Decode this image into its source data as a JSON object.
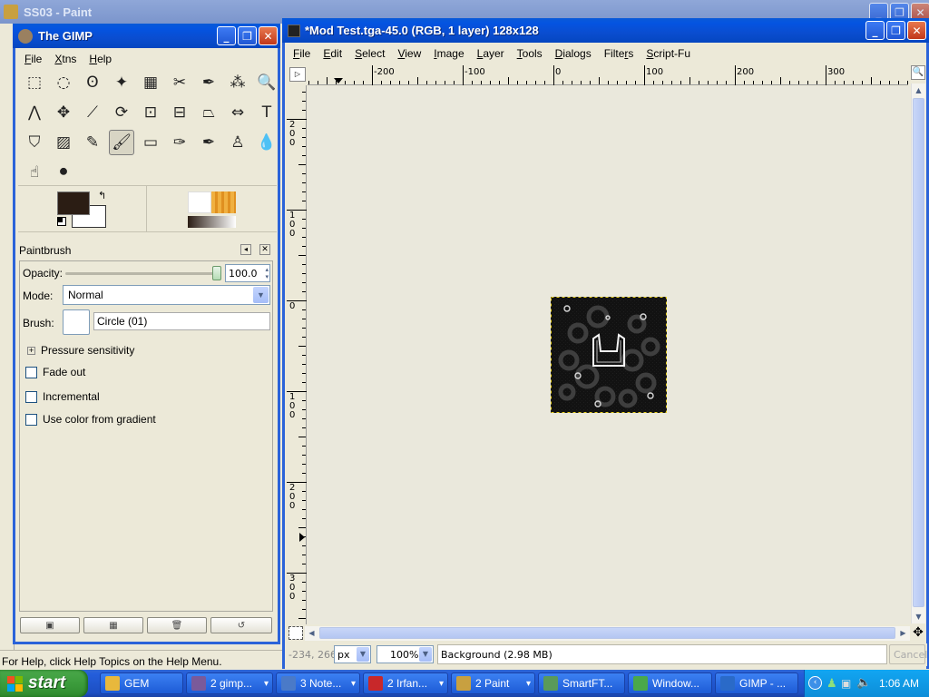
{
  "paint_window": {
    "title": "SS03 - Paint",
    "status": "For Help, click Help Topics on the Help Menu."
  },
  "toolbox": {
    "title": "The GIMP",
    "menu": [
      "File",
      "Xtns",
      "Help"
    ],
    "menu_underline": [
      "F",
      "X",
      "H"
    ],
    "colors": {
      "fg": "#2b1d14",
      "bg": "#ffffff"
    },
    "tools": [
      "rect-select",
      "ellipse-select",
      "free-select",
      "fuzzy-select",
      "select-by-color",
      "scissors",
      "paths",
      "color-picker",
      "zoom",
      "measure",
      "move",
      "crop",
      "rotate",
      "scale",
      "shear",
      "perspective",
      "flip",
      "text",
      "bucket-fill",
      "blend",
      "pencil",
      "paintbrush",
      "eraser",
      "airbrush",
      "ink",
      "clone",
      "convolve",
      "smudge",
      "dodge-burn"
    ],
    "tool_glyphs": [
      "⬚",
      "◌",
      "ʘ",
      "✦",
      "▦",
      "✂",
      "✒",
      "⁂",
      "🔍",
      "⋀",
      "✥",
      "⟋",
      "⟳",
      "⊡",
      "⊟",
      "⏢",
      "⇔",
      "T",
      "⛉",
      "▨",
      "✎",
      "🖌",
      "▭",
      "✑",
      "✒",
      "♙",
      "💧",
      "☝",
      "⚫"
    ]
  },
  "tool_options": {
    "title": "Paintbrush",
    "opacity_label": "Opacity:",
    "opacity_value": "100.0",
    "opacity_level": 100,
    "mode_label": "Mode:",
    "mode_value": "Normal",
    "brush_label": "Brush:",
    "brush_value": "Circle (01)",
    "pressure_label": "Pressure sensitivity",
    "fade_label": "Fade out",
    "incremental_label": "Incremental",
    "gradient_label": "Use color from gradient"
  },
  "image_window": {
    "title": "*Mod Test.tga-45.0 (RGB, 1 layer) 128x128",
    "menu": [
      "File",
      "Edit",
      "Select",
      "View",
      "Image",
      "Layer",
      "Tools",
      "Dialogs",
      "Filters",
      "Script-Fu"
    ],
    "menu_underline": [
      "F",
      "E",
      "S",
      "V",
      "I",
      "L",
      "T",
      "D",
      "r",
      "S"
    ],
    "hruler": [
      "-200",
      "-100",
      "0",
      "100",
      "200",
      "300"
    ],
    "vruler": [
      "1\n0\n0",
      "2\n0\n0",
      "1\n0\n0",
      "0",
      "1\n0\n0",
      "2\n0\n0",
      "3\n0\n0"
    ],
    "coords": "-234, 266",
    "unit": "px",
    "zoom": "100%",
    "status": "Background (2.98 MB)",
    "cancel": "Cancel"
  },
  "taskbar": {
    "start": "start",
    "items": [
      "GEM",
      "2 gimp...",
      "3 Note...",
      "2 Irfan...",
      "2 Paint",
      "SmartFT...",
      "Window...",
      "GIMP - ..."
    ],
    "item_colors": [
      "#e8b83c",
      "#7a5a9a",
      "#4a7ac8",
      "#c8282a",
      "#c8a040",
      "#5a9a5a",
      "#4aa84a",
      "#2a6ac8"
    ],
    "clock": "1:06 AM"
  }
}
